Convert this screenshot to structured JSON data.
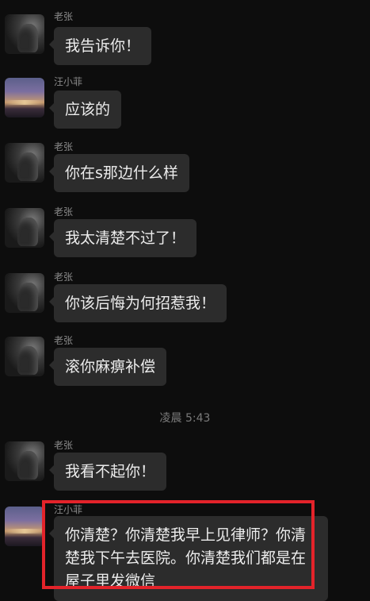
{
  "messages": [
    {
      "sender": "老张",
      "text": "我告诉你！"
    },
    {
      "sender": "汪小菲",
      "text": "应该的"
    },
    {
      "sender": "老张",
      "text": "你在s那边什么样"
    },
    {
      "sender": "老张",
      "text": "我太清楚不过了！"
    },
    {
      "sender": "老张",
      "text": "你该后悔为何招惹我！"
    },
    {
      "sender": "老张",
      "text": "滚你麻痹补偿"
    },
    {
      "sender": "老张",
      "text": "我看不起你！"
    },
    {
      "sender": "汪小菲",
      "text": "你清楚？你清楚我早上见律师？你清楚我下午去医院。你清楚我们都是在屋子里发微信"
    }
  ],
  "timestamp": "凌晨 5:43",
  "colors": {
    "background": "#0d0d0d",
    "bubble": "#2c2c2c",
    "highlight": "#e3232a"
  }
}
